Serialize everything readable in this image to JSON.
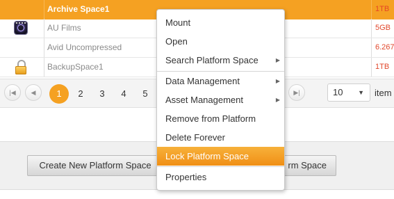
{
  "table": {
    "rows": [
      {
        "name": "Archive Space1",
        "size": "1TB",
        "icon": "",
        "selected": true
      },
      {
        "name": "AU Films",
        "size": "5GB",
        "icon": "film-reel-icon",
        "selected": false
      },
      {
        "name": "Avid Uncompressed",
        "size": "6.267",
        "icon": "",
        "selected": false
      },
      {
        "name": "BackupSpace1",
        "size": "1TB",
        "icon": "lock-icon",
        "selected": false
      }
    ]
  },
  "pager": {
    "first_icon": "first-page-icon",
    "prev_icon": "previous-page-icon",
    "next_icon": "next-page-icon",
    "last_icon": "last-page-icon",
    "first_glyph": "|◀",
    "prev_glyph": "◀",
    "last_glyph": "▶|",
    "pages": [
      "1",
      "2",
      "3",
      "4",
      "5"
    ],
    "current_page": "1",
    "page_size": "10",
    "items_label": "item"
  },
  "buttons": {
    "create": "Create New Platform Space",
    "second": "rm Space"
  },
  "context_menu": {
    "items": [
      {
        "label": "Mount",
        "submenu": false
      },
      {
        "label": "Open",
        "submenu": false
      },
      {
        "label": "Search Platform Space",
        "submenu": true
      },
      {
        "label": "Data Management",
        "submenu": true
      },
      {
        "label": "Asset Management",
        "submenu": true
      },
      {
        "label": "Remove from Platform",
        "submenu": false
      },
      {
        "label": "Delete Forever",
        "submenu": false
      },
      {
        "label": "Lock Platform Space",
        "submenu": false
      },
      {
        "label": "Properties",
        "submenu": false
      }
    ],
    "highlighted": "Lock Platform Space",
    "submenu_arrow": "▶"
  },
  "colors": {
    "accent": "#f5a122",
    "size_text": "#e1482c",
    "menu_highlight": "#f39a1f"
  }
}
